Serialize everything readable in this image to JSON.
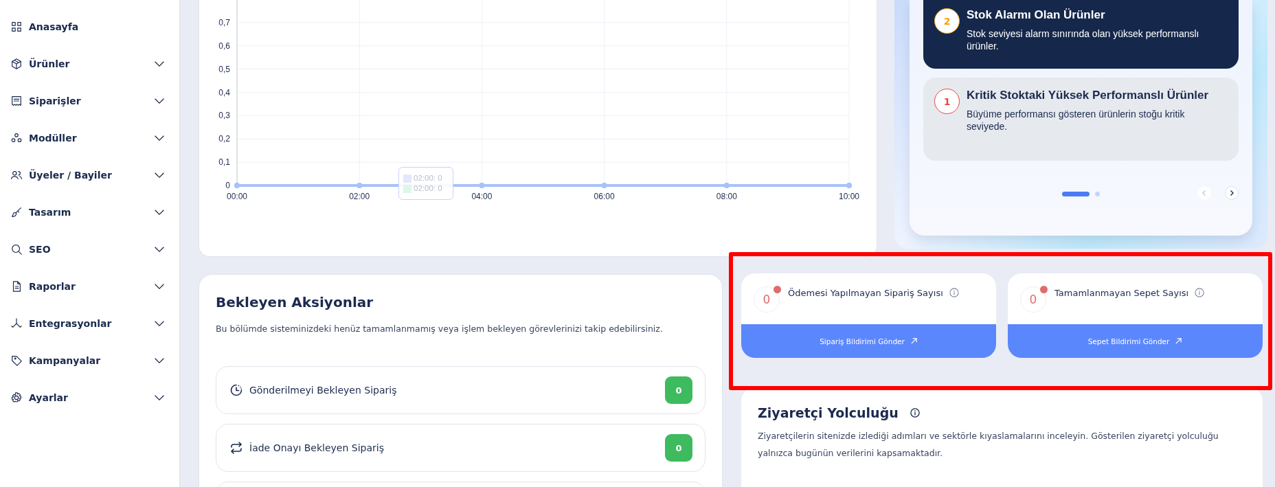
{
  "sidebar": {
    "items": [
      {
        "label": "Anasayfa",
        "kind": "link"
      },
      {
        "label": "Ürünler",
        "kind": "group"
      },
      {
        "label": "Siparişler",
        "kind": "group"
      },
      {
        "label": "Modüller",
        "kind": "group"
      },
      {
        "label": "Üyeler / Bayiler",
        "kind": "group"
      },
      {
        "label": "Tasarım",
        "kind": "group"
      },
      {
        "label": "SEO",
        "kind": "group"
      },
      {
        "label": "Raporlar",
        "kind": "group"
      },
      {
        "label": "Entegrasyonlar",
        "kind": "group"
      },
      {
        "label": "Kampanyalar",
        "kind": "group"
      },
      {
        "label": "Ayarlar",
        "kind": "group"
      }
    ]
  },
  "sales_chart": {
    "chart_data": {
      "type": "line",
      "categories": [
        "00:00",
        "02:00",
        "04:00",
        "06:00",
        "08:00",
        "10:00"
      ],
      "series": [
        {
          "color": "#b7ecc9",
          "marker": "circle",
          "values": [
            0,
            0,
            0,
            0,
            0,
            0
          ]
        },
        {
          "color": "#a8c1fa",
          "marker": "circle",
          "values": [
            0,
            0,
            0,
            0,
            0,
            0
          ]
        }
      ],
      "grid": true,
      "ylim": [
        0,
        0.8
      ],
      "yticks": [
        {
          "value": 0,
          "label": "0"
        },
        {
          "value": 0.1,
          "label": "0,1"
        },
        {
          "value": 0.2,
          "label": "0,2"
        },
        {
          "value": 0.3,
          "label": "0,3"
        },
        {
          "value": 0.4,
          "label": "0,4"
        },
        {
          "value": 0.5,
          "label": "0,5"
        },
        {
          "value": 0.6,
          "label": "0,6"
        },
        {
          "value": 0.7,
          "label": "0,7"
        }
      ]
    },
    "tooltip": [
      {
        "text": "02:00: 0",
        "color": "#e3e8fb"
      },
      {
        "text": "02:00: 0",
        "color": "#dcf7e5"
      }
    ]
  },
  "insights": {
    "items": [
      {
        "rank": "2",
        "color": "#f59e0b",
        "title": "Stok Alarmı Olan Ürünler",
        "description": "Stok seviyesi alarm sınırında olan yüksek performanslı ürünler.",
        "selected": true
      },
      {
        "rank": "1",
        "color": "#ef4444",
        "title": "Kritik Stoktaki Yüksek Performanslı Ürünler",
        "description": "Büyüme performansı gösteren ürünlerin stoğu kritik seviyede.",
        "selected": false
      }
    ],
    "pages": [
      {
        "selected": true
      },
      {
        "selected": false
      }
    ],
    "prev": {
      "disabled": true
    },
    "next": {
      "disabled": false
    }
  },
  "pending_actions": {
    "title": "Bekleyen Aksiyonlar",
    "description": "Bu bölümde sisteminizdeki henüz tamamlanmamış veya işlem bekleyen görevlerinizi takip edebilirsiniz.",
    "rows": [
      {
        "label": "Gönderilmeyi Bekleyen Sipariş",
        "count": "0"
      },
      {
        "label": "İade Onayı Bekleyen Sipariş",
        "count": "0"
      }
    ]
  },
  "stats": [
    {
      "count": "0",
      "title": "Ödemesi Yapılmayan Sipariş Sayısı",
      "button": "Sipariş Bildirimi Gönder"
    },
    {
      "count": "0",
      "title": "Tamamlanmayan Sepet Sayısı",
      "button": "Sepet Bildirimi Gönder"
    }
  ],
  "visitor_journey": {
    "title": "Ziyaretçi Yolculuğu",
    "description": "Ziyaretçilerin sitenizde izlediği adımları ve sektörle kıyaslamalarını inceleyin. Gösterilen ziyaretçi yolculuğu yalnızca bugünün verilerini kapsamaktadır."
  }
}
